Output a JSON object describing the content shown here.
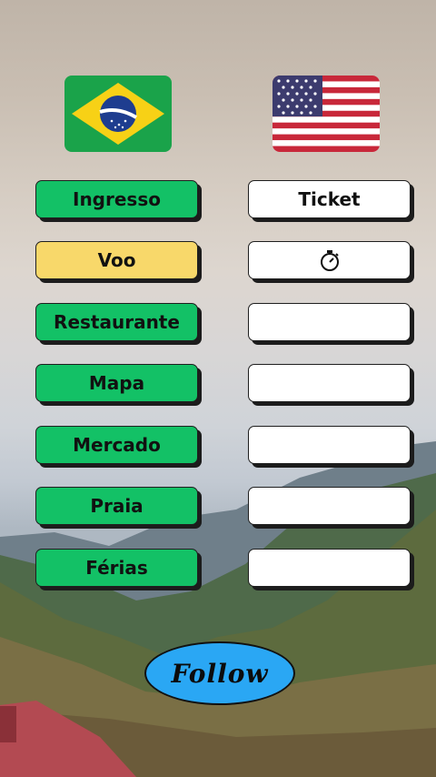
{
  "flags": {
    "left": {
      "icon": "brazil-flag-icon"
    },
    "right": {
      "icon": "usa-flag-icon"
    }
  },
  "words": [
    {
      "pt": "Ingresso",
      "en": "Ticket",
      "state": "answered"
    },
    {
      "pt": "Voo",
      "en": "",
      "state": "active",
      "right_icon": "stopwatch-icon"
    },
    {
      "pt": "Restaurante",
      "en": "",
      "state": "pending"
    },
    {
      "pt": "Mapa",
      "en": "",
      "state": "pending"
    },
    {
      "pt": "Mercado",
      "en": "",
      "state": "pending"
    },
    {
      "pt": "Praia",
      "en": "",
      "state": "pending"
    },
    {
      "pt": "Férias",
      "en": "",
      "state": "pending"
    }
  ],
  "follow_label": "Follow",
  "colors": {
    "green": "#13c166",
    "yellow": "#f8d86a",
    "white": "#ffffff",
    "follow_blue": "#2aa7f4"
  }
}
